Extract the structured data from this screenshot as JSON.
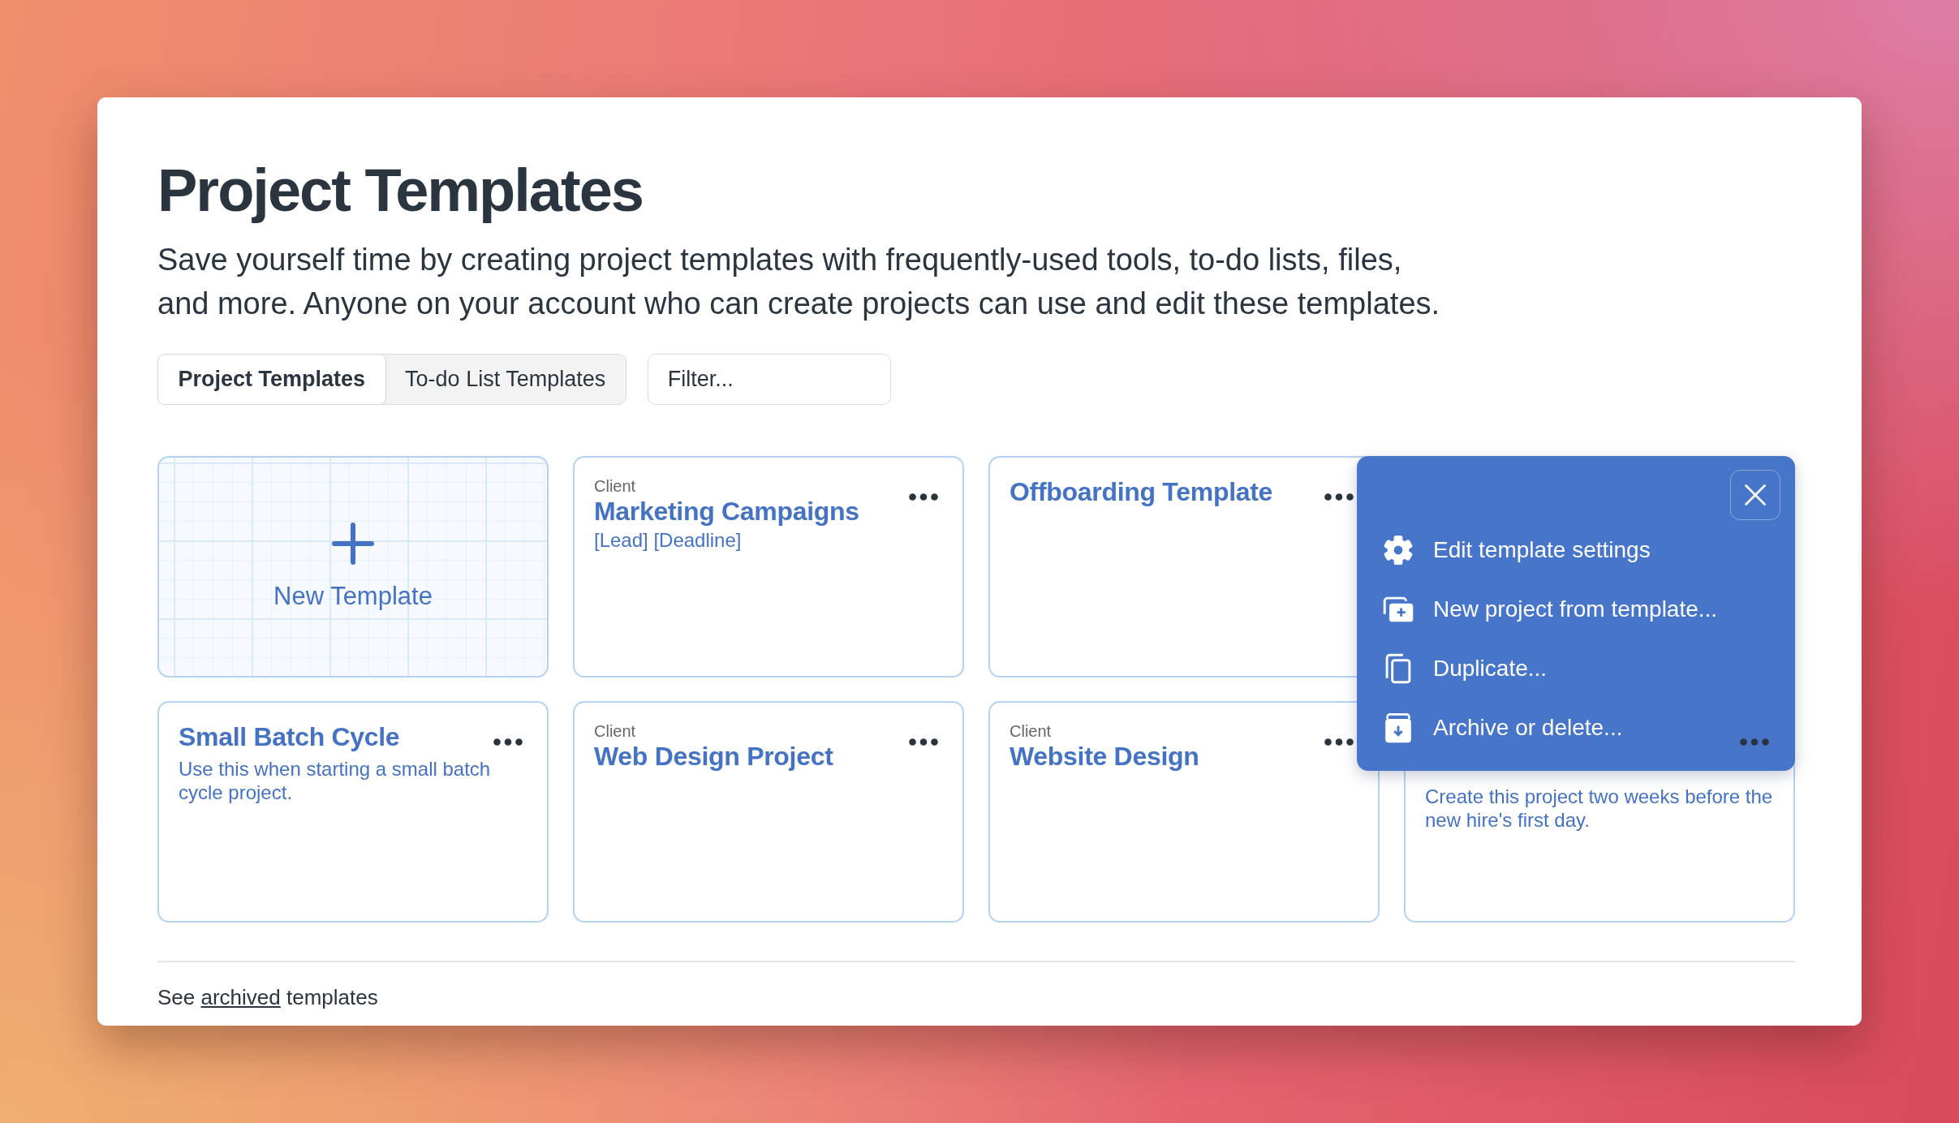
{
  "page": {
    "title": "Project Templates",
    "description": "Save yourself time by creating project templates with frequently-used tools, to-do lists, files, and more. Anyone on your account who can create projects can use and edit these templates."
  },
  "tabs": [
    {
      "label": "Project Templates",
      "selected": true
    },
    {
      "label": "To-do List Templates",
      "selected": false
    }
  ],
  "filter": {
    "placeholder": "Filter..."
  },
  "templates": [
    {
      "kind": "new",
      "label": "New Template"
    },
    {
      "kind": "template",
      "client_label": "Client",
      "title": "Marketing Campaigns",
      "description": "[Lead] [Deadline]",
      "menu_open": false
    },
    {
      "kind": "template",
      "title": "Offboarding Template",
      "menu_open": false
    },
    {
      "kind": "template",
      "menu_open": true
    },
    {
      "kind": "template",
      "title": "Small Batch Cycle",
      "description": "Use this when starting a small batch cycle project.",
      "menu_open": false
    },
    {
      "kind": "template",
      "client_label": "Client",
      "title": "Web Design Project",
      "menu_open": false
    },
    {
      "kind": "template",
      "client_label": "Client",
      "title": "Website Design",
      "menu_open": false
    },
    {
      "kind": "template",
      "description": "Create this project two weeks before the new hire's first day.",
      "menu_open": false
    }
  ],
  "template_menu": {
    "items": [
      {
        "kind": "settings",
        "label": "Edit template settings"
      },
      {
        "kind": "create",
        "label": "New project from template..."
      },
      {
        "kind": "duplicate",
        "label": "Duplicate..."
      },
      {
        "kind": "archive",
        "label": "Archive or delete..."
      }
    ]
  },
  "footer": {
    "prefix": "See",
    "link": "archived",
    "suffix": "templates"
  }
}
